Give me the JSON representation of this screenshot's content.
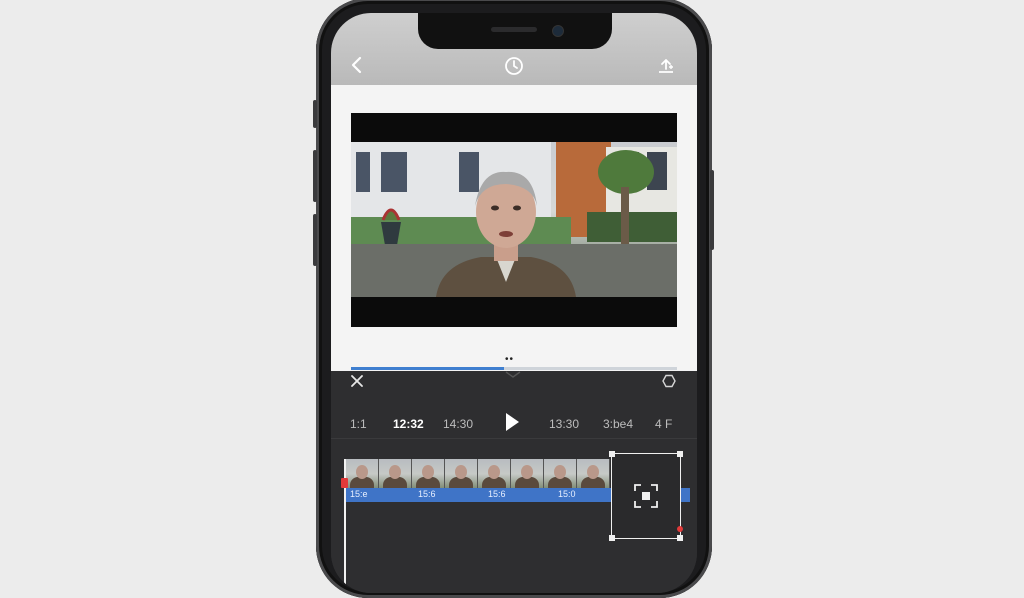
{
  "topbar": {
    "back_icon": "chevron-left-icon",
    "center_icon": "timer-icon",
    "export_icon": "export-upload-icon"
  },
  "preview": {
    "page_dots": "••",
    "progress_percent": 47
  },
  "controls": {
    "close_icon": "close-icon",
    "shape_icon": "hexagon-icon",
    "times": [
      "1:1",
      "12:32",
      "14:30",
      "13:30",
      "3:be4",
      "4 F"
    ],
    "active_time_index": 1,
    "play_icon": "play-icon"
  },
  "timeline": {
    "labels": [
      "15:e",
      "15:6",
      "15:6",
      "15:0"
    ],
    "focus_icon": "focus-frame-icon"
  },
  "colors": {
    "accent": "#3f74c7",
    "marker": "#e23a3a"
  }
}
